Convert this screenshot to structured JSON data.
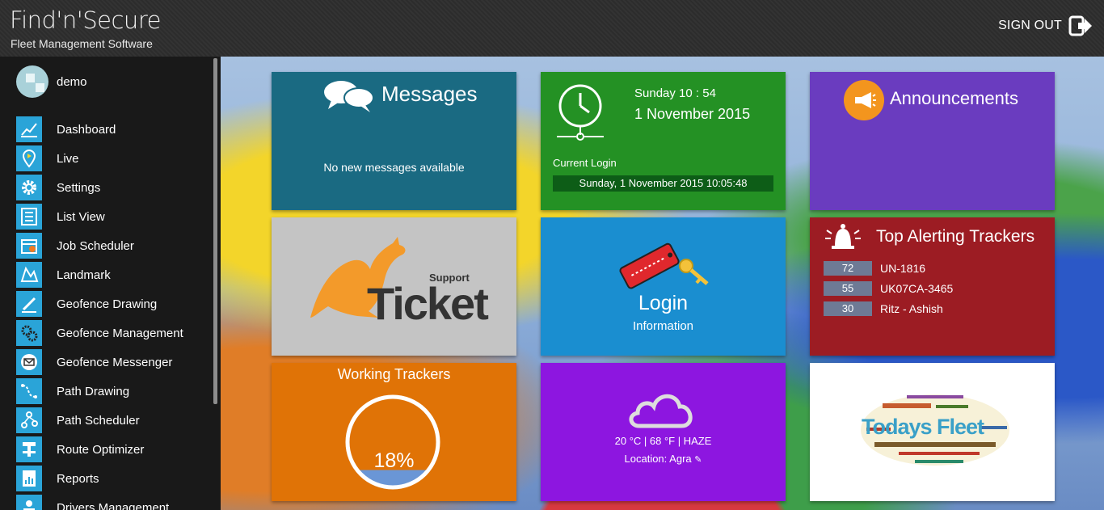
{
  "header": {
    "logo_title": "Find'n'Secure",
    "logo_subtitle": "Fleet Management Software",
    "signout_label": "SIGN OUT"
  },
  "sidebar": {
    "user": "demo",
    "items": [
      {
        "label": "Dashboard",
        "icon": "chart-line-icon"
      },
      {
        "label": "Live",
        "icon": "map-pin-icon"
      },
      {
        "label": "Settings",
        "icon": "gear-icon"
      },
      {
        "label": "List View",
        "icon": "list-icon"
      },
      {
        "label": "Job Scheduler",
        "icon": "calendar-icon"
      },
      {
        "label": "Landmark",
        "icon": "landmark-icon"
      },
      {
        "label": "Geofence Drawing",
        "icon": "pen-icon"
      },
      {
        "label": "Geofence Management",
        "icon": "gears-icon"
      },
      {
        "label": "Geofence Messenger",
        "icon": "envelope-icon"
      },
      {
        "label": "Path Drawing",
        "icon": "path-icon"
      },
      {
        "label": "Path Scheduler",
        "icon": "nodes-icon"
      },
      {
        "label": "Route Optimizer",
        "icon": "route-icon"
      },
      {
        "label": "Reports",
        "icon": "report-icon"
      },
      {
        "label": "Drivers Management",
        "icon": "driver-icon"
      }
    ]
  },
  "tiles": {
    "messages": {
      "title": "Messages",
      "body": "No new messages available"
    },
    "datetime": {
      "day_time": "Sunday 10 : 54",
      "date": "1 November 2015",
      "current_login_label": "Current Login",
      "current_login_value": "Sunday, 1 November 2015 10:05:48"
    },
    "announcements": {
      "title": "Announcements"
    },
    "ticket": {
      "support": "Support",
      "word": "Ticket"
    },
    "login": {
      "title": "Login",
      "subtitle": "Information"
    },
    "top_alerting": {
      "title": "Top Alerting Trackers",
      "rows": [
        {
          "count": "72",
          "name": "UN-1816"
        },
        {
          "count": "55",
          "name": "UK07CA-3465"
        },
        {
          "count": "30",
          "name": "Ritz - Ashish"
        }
      ]
    },
    "working": {
      "title": "Working Trackers",
      "percent_label": "18%",
      "percent": 18
    },
    "weather": {
      "temp": "20 °C | 68 °F | HAZE",
      "location": "Location: Agra"
    },
    "word_cloud": {
      "main": "Todays Fleet"
    }
  },
  "colors": {
    "messages": "#1a6a82",
    "datetime": "#249124",
    "announcements": "#6a3cbf",
    "ticket": "#c4c4c4",
    "login": "#1a8ed0",
    "alerting": "#9c1c23",
    "working": "#e07306",
    "weather": "#8d16e0",
    "nav_icon": "#2aa4d8"
  }
}
